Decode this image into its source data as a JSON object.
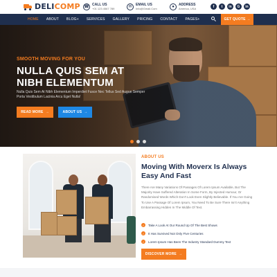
{
  "colors": {
    "brand_navy": "#1f2f4e",
    "accent_orange": "#f47c20",
    "button_blue": "#1e88e5"
  },
  "logo": {
    "part1": "DELI",
    "part2": "COMP",
    "icon": "truck-icon"
  },
  "contacts": [
    {
      "icon": "phone-icon",
      "title": "CALL US",
      "value": "+01 123 4567 789"
    },
    {
      "icon": "mail-icon",
      "title": "EMAIL US",
      "value": "Info@Gmail.Com"
    },
    {
      "icon": "location-icon",
      "title": "ADDRESS",
      "value": "America, USA"
    }
  ],
  "socials": [
    "f",
    "t",
    "in",
    "G",
    "in"
  ],
  "nav": {
    "items": [
      "HOME",
      "ABOUT",
      "BLOG+",
      "SERVICES",
      "GALLERY",
      "PRICING",
      "CONTACT",
      "PAGES+"
    ],
    "cta": "GET QUOTE"
  },
  "hero": {
    "kicker": "SMOOTH MOVING FOR YOU",
    "title": "NULLA QUIS SEM AT NIBH ELEMENTUM",
    "text": "Nulla Quis Sem At Nibh Elementum Imperdiet Fusce Nec Tellus Sed Augue Semper Porta Vestibulum Lacinia Arcu Eget Nulla!",
    "btn_primary": "READ MORE",
    "btn_secondary": "ABOUT US",
    "slides": 3,
    "active_slide": 1
  },
  "about": {
    "kicker": "ABOUT US",
    "title": "Moving With Moverx Is Always Easy And Fast",
    "text": "There Are Many Variations Of Passages Of Lorem Ipsum Available, But The Majority Have Suffered Alteration In Some Form, By Injected Humour, Or Randomised Words Which Don't Look Even Slightly Believable. If You Are Going To Use A Passage Of Lorem Ipsum, You Need To Be Sure There Isn't Anything Embarrassing Hidden In The Middle Of Text.",
    "checklist": [
      "Take A Look At Our Round Up Of The Best Shows",
      "It Has Survived Not Only Five Centuries",
      "Lorem Ipsum Has Been The Industry Standard Dummy Text"
    ],
    "button": "DISCOVER MORE"
  }
}
